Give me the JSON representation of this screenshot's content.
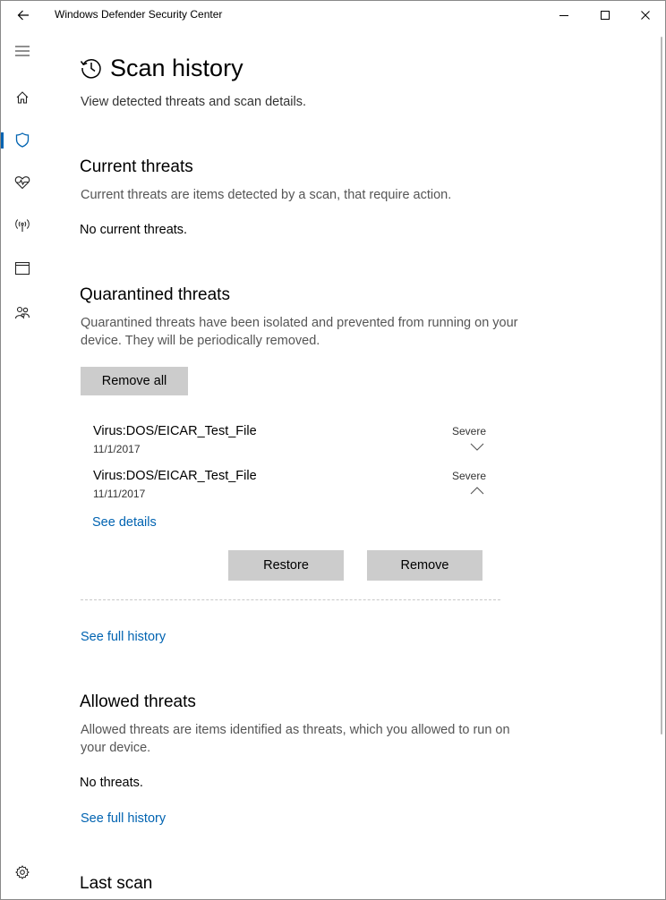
{
  "window": {
    "title": "Windows Defender Security Center"
  },
  "icons": {
    "back": "back-arrow-icon",
    "minimize": "minimize-icon",
    "maximize": "maximize-icon",
    "close": "close-icon",
    "menu": "hamburger-menu-icon",
    "home": "home-icon",
    "shield": "shield-icon",
    "health": "heart-pulse-icon",
    "network": "wireless-antenna-icon",
    "app_browser": "browser-window-icon",
    "family": "family-icon",
    "settings": "gear-icon",
    "history": "history-clock-icon"
  },
  "colors": {
    "accent": "#0063b1",
    "button_bg": "#cccccc"
  },
  "page": {
    "title": "Scan history",
    "subtitle": "View detected threats and scan details."
  },
  "current_threats": {
    "heading": "Current threats",
    "description": "Current threats are items detected by a scan, that require action.",
    "status": "No current threats."
  },
  "quarantined_threats": {
    "heading": "Quarantined threats",
    "description": "Quarantined threats have been isolated and prevented from running on your device.  They will be periodically removed.",
    "remove_all_label": "Remove all",
    "items": [
      {
        "name": "Virus:DOS/EICAR_Test_File",
        "date": "11/1/2017",
        "severity": "Severe",
        "expanded": false
      },
      {
        "name": "Virus:DOS/EICAR_Test_File",
        "date": "11/11/2017",
        "severity": "Severe",
        "expanded": true
      }
    ],
    "see_details_label": "See details",
    "restore_label": "Restore",
    "remove_label": "Remove",
    "see_full_history_label": "See full history"
  },
  "allowed_threats": {
    "heading": "Allowed threats",
    "description": "Allowed threats are items identified as threats, which you allowed to run on your device.",
    "status": "No threats.",
    "see_full_history_label": "See full history"
  },
  "last_scan": {
    "heading": "Last scan"
  }
}
